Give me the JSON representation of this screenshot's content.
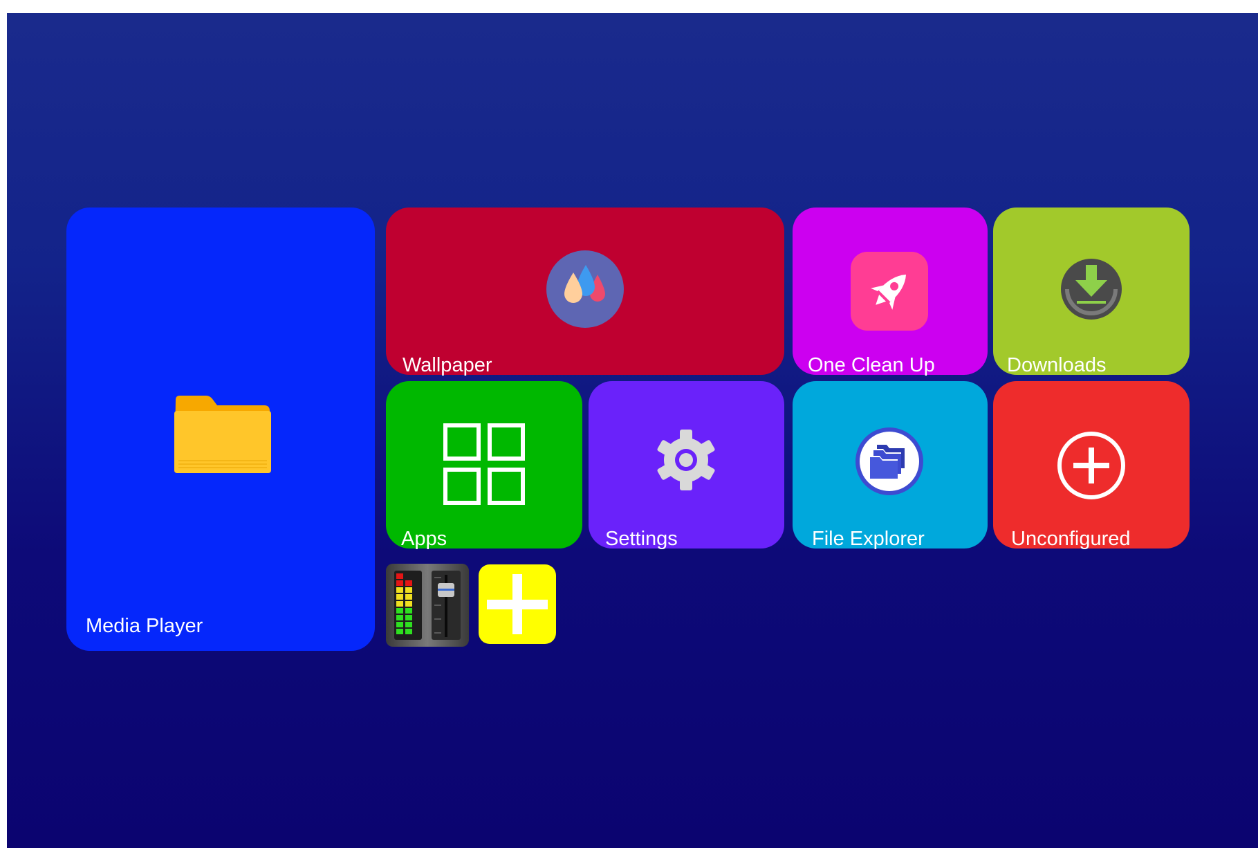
{
  "tiles": {
    "media_player": {
      "label": "Media Player",
      "icon": "folder-icon",
      "color": "#0527fb"
    },
    "wallpaper": {
      "label": "Wallpaper",
      "icon": "drops-icon",
      "color": "#bf0030"
    },
    "one_clean_up": {
      "label": "One Clean Up",
      "icon": "rocket-icon",
      "color": "#cc00f0"
    },
    "downloads": {
      "label": "Downloads",
      "icon": "download-icon",
      "color": "#a2c92b"
    },
    "apps": {
      "label": "Apps",
      "icon": "apps-grid-icon",
      "color": "#00b800"
    },
    "settings": {
      "label": "Settings",
      "icon": "gear-icon",
      "color": "#6a22fa"
    },
    "file_explorer": {
      "label": "File Explorer",
      "icon": "folders-icon",
      "color": "#00a8dc"
    },
    "unconfigured": {
      "label": "Unconfigured",
      "icon": "plus-circle-icon",
      "color": "#ee2c2c"
    }
  },
  "small_tiles": {
    "music_mixer": {
      "icon": "music-mixer-icon"
    },
    "add": {
      "icon": "plus-icon",
      "color": "#ffff00"
    }
  },
  "background": {
    "top": "#1a2a8c",
    "bottom": "#0b0470"
  }
}
